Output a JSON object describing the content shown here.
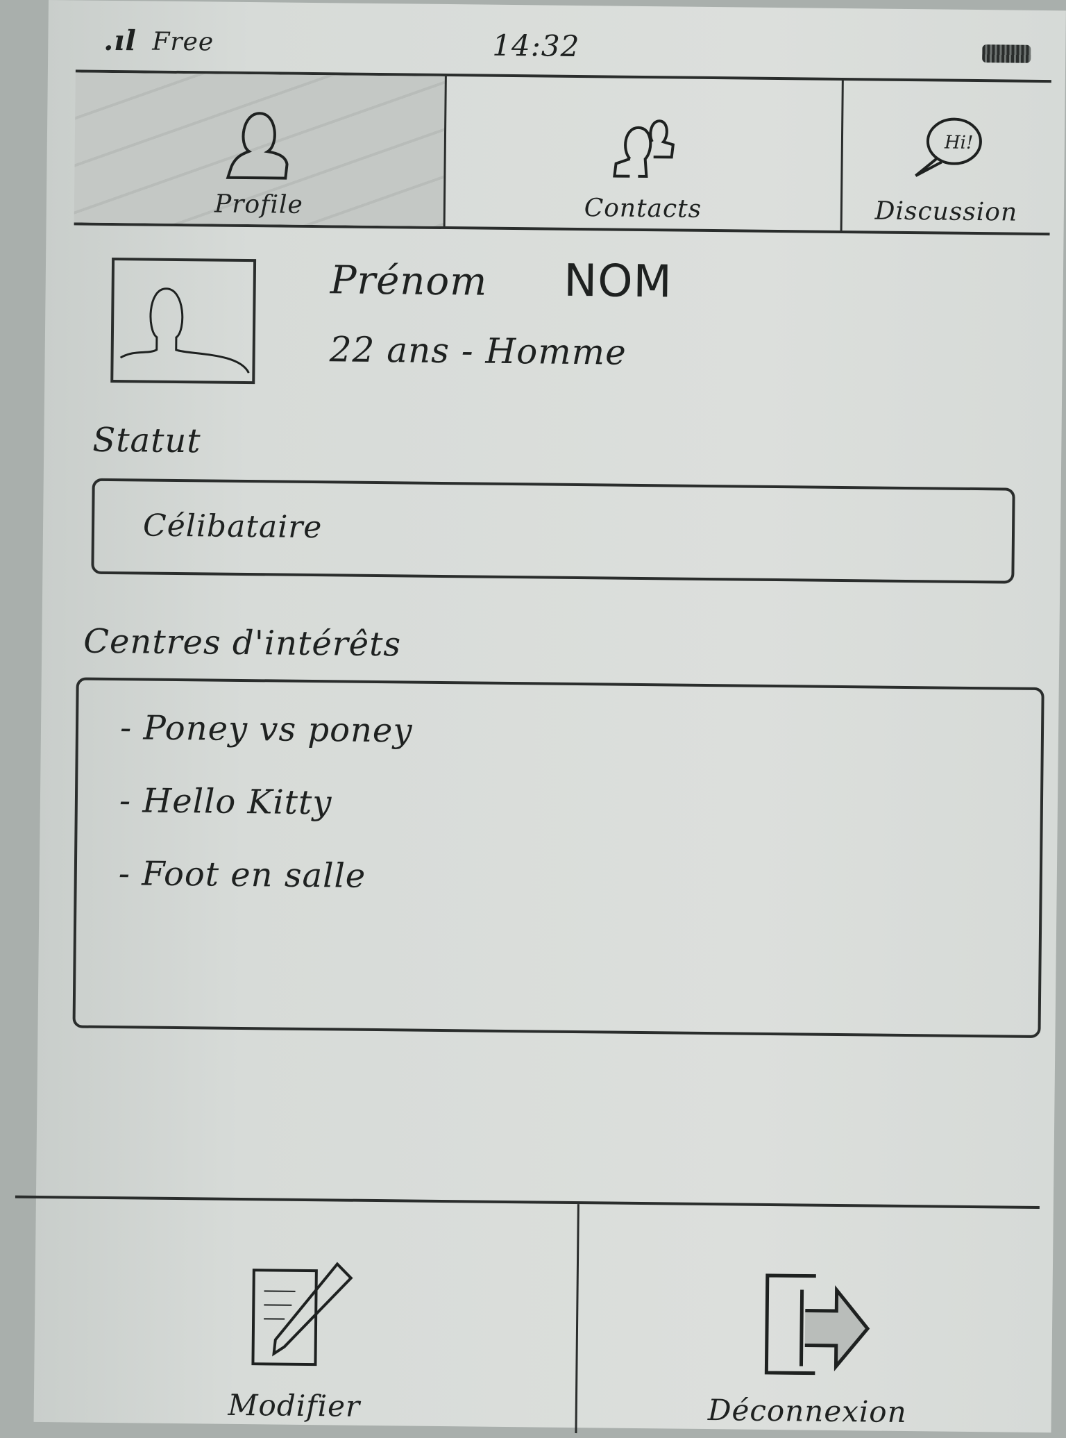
{
  "status_bar": {
    "signal": ".ıl",
    "carrier": "Free",
    "time": "14:32",
    "battery_icon": "battery-icon"
  },
  "tabs": [
    {
      "label": "Profile",
      "icon": "person-icon",
      "active": true
    },
    {
      "label": "Contacts",
      "icon": "people-icon",
      "active": false
    },
    {
      "label": "Discussion",
      "icon": "speech-bubble-icon",
      "active": false
    }
  ],
  "profile": {
    "first_name": "Prénom",
    "last_name": "NOM",
    "age_gender": "22 ans - Homme"
  },
  "statut": {
    "label": "Statut",
    "value": "Célibataire"
  },
  "interests": {
    "label": "Centres d'intérêts",
    "items": [
      "- Poney vs poney",
      "- Hello Kitty",
      "- Foot en salle"
    ]
  },
  "bottom_bar": {
    "edit": {
      "label": "Modifier",
      "icon": "edit-icon"
    },
    "logout": {
      "label": "Déconnexion",
      "icon": "logout-icon"
    }
  }
}
